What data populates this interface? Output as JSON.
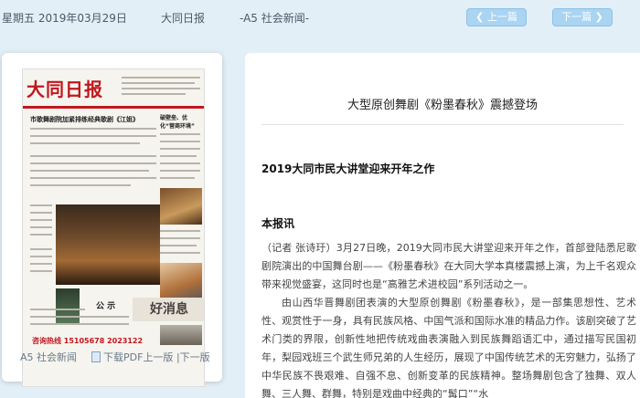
{
  "topbar": {
    "date": "星期五 2019年03月29日",
    "paper_name": "大同日报",
    "section": "-A5 社会新闻-",
    "prev_label": "上一篇",
    "next_label": "下一篇"
  },
  "thumbnail": {
    "masthead": "大同日报",
    "headline": "市歌舞剧院加紧排练经典歌剧《江姐》",
    "side_headline": "破壁垒、优化“营商环境”",
    "notice": "公 示",
    "ad_text": "好消息",
    "phone": "咨询热线 15105678 2023122"
  },
  "card_footer": {
    "page_label": "A5 社会新闻",
    "pdf_label": "下载PDF",
    "prev_version": "上一版",
    "next_version": "|下一版"
  },
  "article": {
    "title": "大型原创舞剧《粉墨春秋》震撼登场",
    "subtitle": "2019大同市民大讲堂迎来开年之作",
    "lead": "本报讯",
    "paragraphs": [
      "（记者 张诗玗）3月27日晚，2019大同市民大讲堂迎来开年之作，首部登陆悉尼歌剧院演出的中国舞台剧——《粉墨春秋》在大同大学本真楼震撼上演，为上千名观众带来视觉盛宴，这同时也是“高雅艺术进校园”系列活动之一。",
      "由山西华晋舞剧团表演的大型原创舞剧《粉墨春秋》，是一部集思想性、艺术性、观赏性于一身，具有民族风格、中国气派和国际水准的精品力作。该剧突破了艺术门类的界限，创新性地把传统戏曲表演融入到民族舞蹈语汇中，通过描写民国初年，梨园戏班三个武生师兄弟的人生经历，展现了中国传统艺术的无穷魅力，弘扬了中华民族不畏艰难、自强不息、创新变革的民族精神。整场舞剧包含了独舞、双人舞、三人舞、群舞，特别是戏曲中经典的“髯口”“水"
    ]
  }
}
